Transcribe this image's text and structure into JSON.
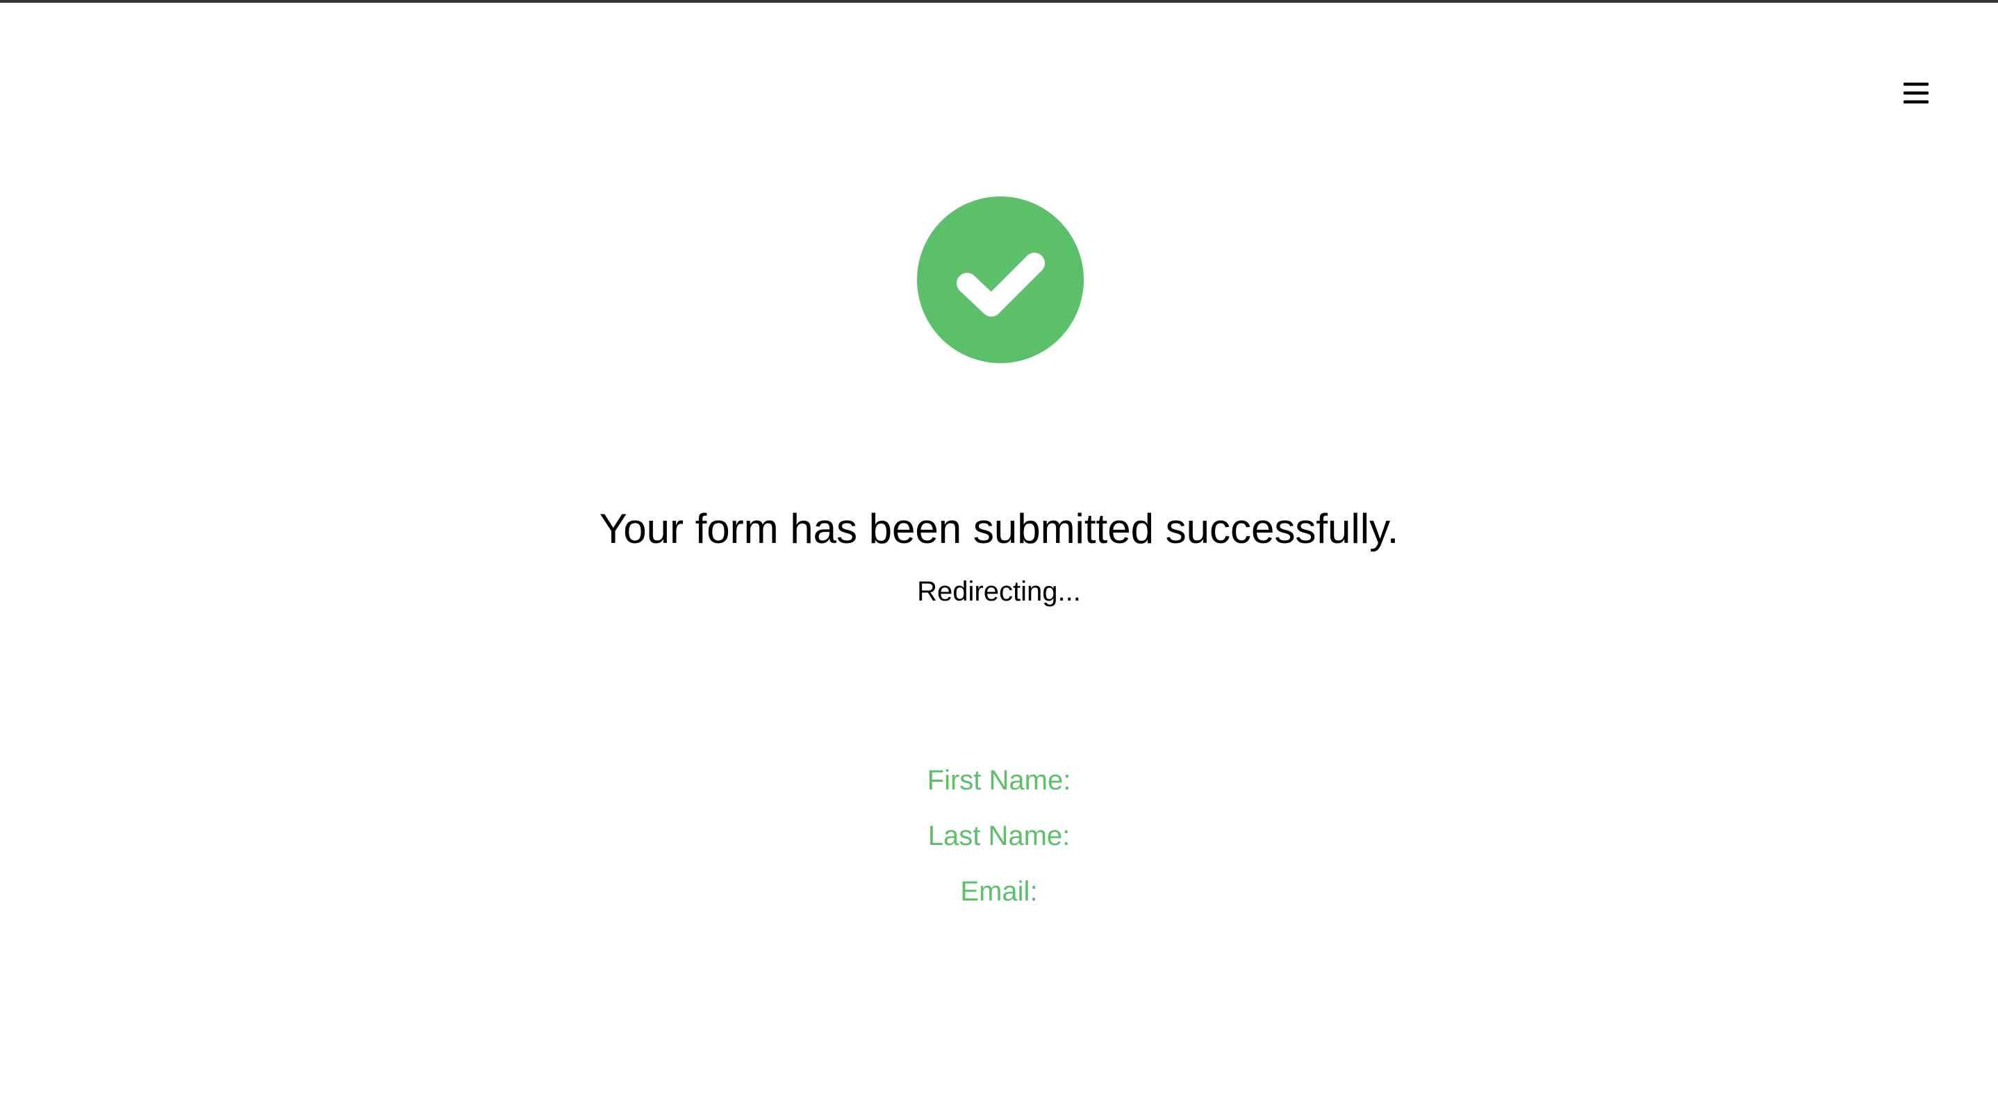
{
  "header": {
    "menu_icon": "hamburger-menu-icon"
  },
  "status": {
    "icon": "check-circle-icon",
    "icon_color": "#5cbf6a",
    "title": "Your form has been submitted successfully.",
    "subtitle": "Redirecting..."
  },
  "summary": {
    "accent_color": "#5cbf6a",
    "fields": [
      {
        "label": "First Name:"
      },
      {
        "label": "Last Name:"
      },
      {
        "label": "Email:"
      }
    ]
  }
}
